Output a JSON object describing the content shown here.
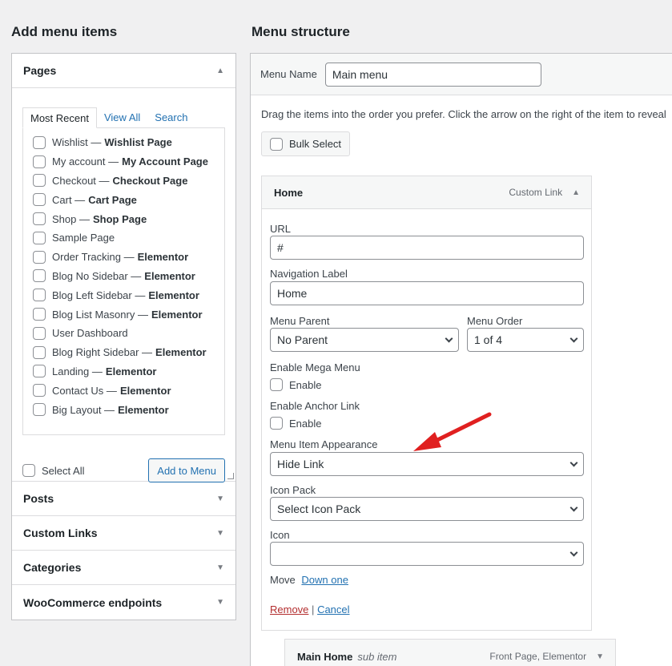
{
  "left": {
    "title": "Add menu items",
    "pages": {
      "heading": "Pages",
      "tabs": [
        "Most Recent",
        "View All",
        "Search"
      ],
      "items": [
        {
          "name": "Wishlist",
          "tag": "Wishlist Page"
        },
        {
          "name": "My account",
          "tag": "My Account Page"
        },
        {
          "name": "Checkout",
          "tag": "Checkout Page"
        },
        {
          "name": "Cart",
          "tag": "Cart Page"
        },
        {
          "name": "Shop",
          "tag": "Shop Page"
        },
        {
          "name": "Sample Page",
          "tag": ""
        },
        {
          "name": "Order Tracking",
          "tag": "Elementor"
        },
        {
          "name": "Blog No Sidebar",
          "tag": "Elementor"
        },
        {
          "name": "Blog Left Sidebar",
          "tag": "Elementor"
        },
        {
          "name": "Blog List Masonry",
          "tag": "Elementor"
        },
        {
          "name": "User Dashboard",
          "tag": ""
        },
        {
          "name": "Blog Right Sidebar",
          "tag": "Elementor"
        },
        {
          "name": "Landing",
          "tag": "Elementor"
        },
        {
          "name": "Contact Us",
          "tag": "Elementor"
        },
        {
          "name": "Big Layout",
          "tag": "Elementor"
        }
      ],
      "select_all": "Select All",
      "add_button": "Add to Menu"
    },
    "sections": [
      "Posts",
      "Custom Links",
      "Categories",
      "WooCommerce endpoints"
    ]
  },
  "right": {
    "title": "Menu structure",
    "menu_name_label": "Menu Name",
    "menu_name_value": "Main menu",
    "instructions": "Drag the items into the order you prefer. Click the arrow on the right of the item to reveal",
    "bulk_select": "Bulk Select",
    "item": {
      "title": "Home",
      "type": "Custom Link",
      "url_label": "URL",
      "url_value": "#",
      "nav_label": "Navigation Label",
      "nav_value": "Home",
      "parent_label": "Menu Parent",
      "parent_value": "No Parent",
      "order_label": "Menu Order",
      "order_value": "1 of 4",
      "mega_label": "Enable Mega Menu",
      "mega_enable": "Enable",
      "anchor_label": "Enable Anchor Link",
      "anchor_enable": "Enable",
      "appearance_label": "Menu Item Appearance",
      "appearance_value": "Hide Link",
      "icon_pack_label": "Icon Pack",
      "icon_pack_value": "Select Icon Pack",
      "icon_label": "Icon",
      "icon_value": "",
      "move_label": "Move",
      "move_link": "Down one",
      "remove": "Remove",
      "separator": "|",
      "cancel": "Cancel"
    },
    "sub_item": {
      "title": "Main Home",
      "note": "sub item",
      "type": "Front Page, Elementor"
    }
  },
  "colors": {
    "link": "#2271b1",
    "remove": "#b32d2e",
    "annotation_arrow": "#e02020"
  }
}
